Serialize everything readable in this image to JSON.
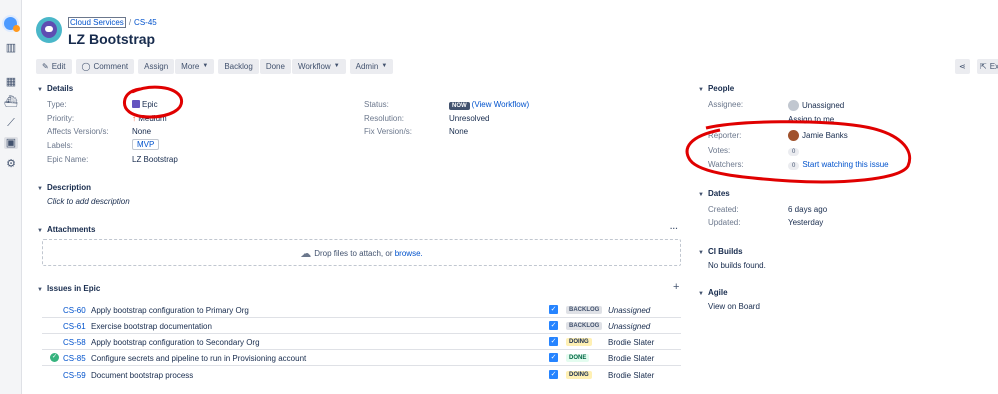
{
  "breadcrumb": {
    "project": "Cloud Services",
    "separator": "/",
    "issue_key": "CS-45"
  },
  "issue_title": "LZ Bootstrap",
  "toolbar": {
    "edit": "Edit",
    "comment": "Comment",
    "assign": "Assign",
    "more": "More",
    "backlog": "Backlog",
    "done": "Done",
    "workflow": "Workflow",
    "admin": "Admin",
    "right_label": "Ex"
  },
  "details": {
    "heading": "Details",
    "fields": [
      {
        "label": "Type:",
        "value": "Epic"
      },
      {
        "label": "Priority:",
        "value": "Medium"
      },
      {
        "label": "Affects Version/s:",
        "value": "None"
      },
      {
        "label": "Labels:",
        "value": "MVP"
      },
      {
        "label": "Epic Name:",
        "value": "LZ Bootstrap"
      }
    ],
    "status_label": "Status:",
    "status_badge": "NOW",
    "status_link": "(View Workflow)",
    "resolution_label": "Resolution:",
    "resolution_value": "Unresolved",
    "fix_label": "Fix Version/s:",
    "fix_value": "None"
  },
  "description": {
    "heading": "Description",
    "placeholder": "Click to add description"
  },
  "attachments": {
    "heading": "Attachments",
    "menu": "···",
    "drop_text": "Drop files to attach, or",
    "browse": "browse."
  },
  "issues_in_epic": {
    "heading": "Issues in Epic",
    "add": "+",
    "rows": [
      {
        "key": "CS-60",
        "summary": "Apply bootstrap configuration to Primary Org",
        "status": "BACKLOG",
        "assignee": "Unassigned",
        "done": false
      },
      {
        "key": "CS-61",
        "summary": "Exercise bootstrap documentation",
        "status": "BACKLOG",
        "assignee": "Unassigned",
        "done": false
      },
      {
        "key": "CS-58",
        "summary": "Apply bootstrap configuration to Secondary Org",
        "status": "DOING",
        "assignee": "Brodie Slater",
        "done": false
      },
      {
        "key": "CS-85",
        "summary": "Configure secrets and pipeline to run in Provisioning account",
        "status": "DONE",
        "assignee": "Brodie Slater",
        "done": true
      },
      {
        "key": "CS-59",
        "summary": "Document bootstrap process",
        "status": "DOING",
        "assignee": "Brodie Slater",
        "done": false
      }
    ]
  },
  "people": {
    "heading": "People",
    "assignee_label": "Assignee:",
    "assignee_value": "Unassigned",
    "assign_to_me": "Assign to me",
    "reporter_label": "Reporter:",
    "reporter_value": "Jamie Banks",
    "votes_label": "Votes:",
    "votes_count": "0",
    "watchers_label": "Watchers:",
    "watchers_count": "0",
    "watch_link": "Start watching this issue"
  },
  "dates": {
    "heading": "Dates",
    "created_label": "Created:",
    "created_value": "6 days ago",
    "updated_label": "Updated:",
    "updated_value": "Yesterday"
  },
  "ci_builds": {
    "heading": "CI Builds",
    "text": "No builds found."
  },
  "agile": {
    "heading": "Agile",
    "link": "View on Board"
  },
  "colors": {
    "link": "#0052cc",
    "annotation": "#e00000",
    "epic": "#6554c0"
  }
}
